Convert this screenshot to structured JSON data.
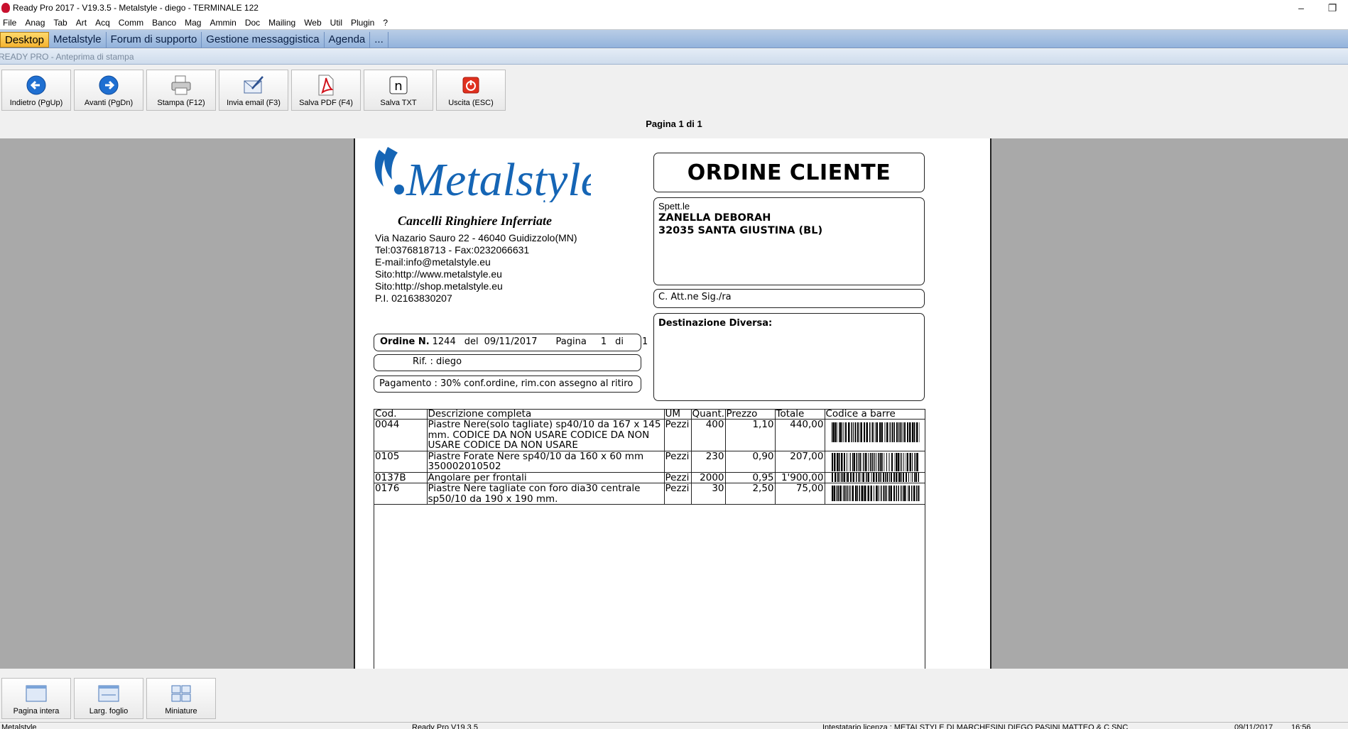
{
  "window": {
    "title": "Ready Pro 2017 - V19.3.5 - Metalstyle - diego - TERMINALE 122",
    "controls": {
      "minimize": "–",
      "restore": "❐"
    }
  },
  "menu": [
    "File",
    "Anag",
    "Tab",
    "Art",
    "Acq",
    "Comm",
    "Banco",
    "Mag",
    "Ammin",
    "Doc",
    "Mailing",
    "Web",
    "Util",
    "Plugin",
    "?"
  ],
  "tabs": [
    "Desktop",
    "Metalstyle",
    "Forum di supporto",
    "Gestione messaggistica",
    "Agenda",
    "..."
  ],
  "subtitle": "READY PRO - Anteprima di stampa",
  "toolbar": [
    {
      "label": "Indietro (PgUp)",
      "icon": "back-arrow-icon"
    },
    {
      "label": "Avanti (PgDn)",
      "icon": "forward-arrow-icon"
    },
    {
      "label": "Stampa (F12)",
      "icon": "printer-icon"
    },
    {
      "label": "Invia email (F3)",
      "icon": "email-icon"
    },
    {
      "label": "Salva PDF (F4)",
      "icon": "pdf-icon"
    },
    {
      "label": "Salva TXT",
      "icon": "txt-icon"
    },
    {
      "label": "Uscita (ESC)",
      "icon": "power-icon"
    }
  ],
  "page_indicator": "Pagina 1 di 1",
  "document": {
    "logo_text": "Metalstyle",
    "tagline": "Cancelli Ringhiere Inferriate",
    "address_lines": [
      "Via Nazario Sauro 22 - 46040 Guidizzolo(MN)",
      "Tel:0376818713 - Fax:0232066631",
      "E-mail:info@metalstyle.eu",
      "Sito:http://www.metalstyle.eu",
      "Sito:http://shop.metalstyle.eu",
      "P.I. 02163830207"
    ],
    "title": "ORDINE CLIENTE",
    "spett": "Spett.le",
    "recipient": [
      "ZANELLA DEBORAH",
      "32035 SANTA GIUSTINA (BL)"
    ],
    "attention": "C. Att.ne Sig./ra",
    "destination_label": "Destinazione Diversa:",
    "order": {
      "label": "Ordine N.",
      "number": "1244",
      "del": "del",
      "date": "09/11/2017",
      "page_label": "Pagina",
      "page": "1",
      "di": "di",
      "pages": "1"
    },
    "rif": "Rif. :  diego",
    "payment": "Pagamento : 30% conf.ordine, rim.con assegno al ritiro",
    "columns": [
      "Cod.",
      "Descrizione completa",
      "UM",
      "Quant.",
      "Prezzo",
      "Totale",
      "Codice a barre"
    ],
    "rows": [
      {
        "cod": "0044",
        "desc": "Piastre Nere(solo tagliate) sp40/10 da 167 x 145 mm.  CODICE DA NON USARE CODICE DA NON USARE CODICE DA NON USARE",
        "um": "Pezzi",
        "qty": "400",
        "price": "1,10",
        "total": "440,00"
      },
      {
        "cod": "0105",
        "desc": "Piastre Forate Nere sp40/10 da 160 x 60 mm  350002010502",
        "um": "Pezzi",
        "qty": "230",
        "price": "0,90",
        "total": "207,00"
      },
      {
        "cod": "0137B",
        "desc": "Angolare per frontali",
        "um": "Pezzi",
        "qty": "2000",
        "price": "0,95",
        "total": "1'900,00"
      },
      {
        "cod": "0176",
        "desc": "Piastre Nere tagliate con foro dia30 centrale sp50/10 da 190 x 190 mm.",
        "um": "Pezzi",
        "qty": "30",
        "price": "2,50",
        "total": "75,00"
      }
    ]
  },
  "view_buttons": [
    {
      "label": "Pagina intera"
    },
    {
      "label": "Larg. foglio"
    },
    {
      "label": "Miniature"
    }
  ],
  "status": {
    "left": "Metalstyle",
    "version": "Ready Pro V19.3.5",
    "license": "Intestatario licenza : METALSTYLE DI MARCHESINI DIEGO PASINI MATTEO & C SNC",
    "date": "09/11/2017",
    "time": "16:56"
  },
  "colors": {
    "tab_active": "#f5b431",
    "tab_bar": "#a6c0e2",
    "logo_blue": "#1565b5",
    "preview_bg": "#a9a9a9"
  }
}
